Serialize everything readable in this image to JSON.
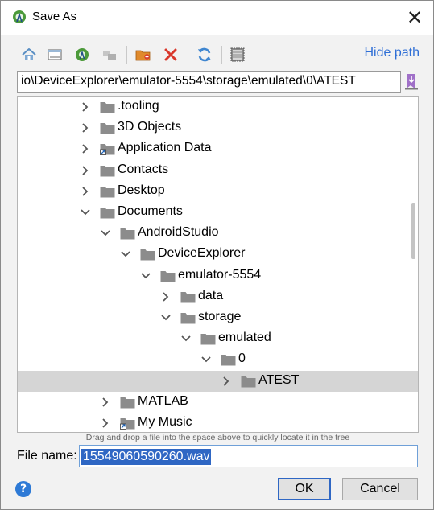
{
  "window": {
    "title": "Save As",
    "close_label": "✕"
  },
  "toolbar": {
    "buttons": [
      "home-icon",
      "desktop-icon",
      "android-project-icon",
      "modules-icon",
      "new-folder-icon",
      "delete-icon",
      "refresh-icon",
      "show-hidden-icon"
    ],
    "hide_path_label": "Hide path"
  },
  "path": {
    "value": "io\\DeviceExplorer\\emulator-5554\\storage\\emulated\\0\\ATEST"
  },
  "tree": {
    "items": [
      {
        "label": ".tooling",
        "expanded": false,
        "depth": 0,
        "shortcut": false
      },
      {
        "label": "3D Objects",
        "expanded": false,
        "depth": 0,
        "shortcut": false
      },
      {
        "label": "Application Data",
        "expanded": false,
        "depth": 0,
        "shortcut": true
      },
      {
        "label": "Contacts",
        "expanded": false,
        "depth": 0,
        "shortcut": false
      },
      {
        "label": "Desktop",
        "expanded": false,
        "depth": 0,
        "shortcut": false
      },
      {
        "label": "Documents",
        "expanded": true,
        "depth": 0,
        "shortcut": false
      },
      {
        "label": "AndroidStudio",
        "expanded": true,
        "depth": 1,
        "shortcut": false
      },
      {
        "label": "DeviceExplorer",
        "expanded": true,
        "depth": 2,
        "shortcut": false
      },
      {
        "label": "emulator-5554",
        "expanded": true,
        "depth": 3,
        "shortcut": false
      },
      {
        "label": "data",
        "expanded": false,
        "depth": 4,
        "shortcut": false
      },
      {
        "label": "storage",
        "expanded": true,
        "depth": 4,
        "shortcut": false
      },
      {
        "label": "emulated",
        "expanded": true,
        "depth": 5,
        "shortcut": false
      },
      {
        "label": "0",
        "expanded": true,
        "depth": 6,
        "shortcut": false
      },
      {
        "label": "ATEST",
        "expanded": false,
        "depth": 7,
        "shortcut": false,
        "selected": true
      },
      {
        "label": "MATLAB",
        "expanded": false,
        "depth": 1,
        "shortcut": false
      },
      {
        "label": "My Music",
        "expanded": false,
        "depth": 1,
        "shortcut": true
      }
    ]
  },
  "hint": "Drag and drop a file into the space above to quickly locate it in the tree",
  "file_name": {
    "label": "File name:",
    "value": "15549060590260.wav"
  },
  "buttons": {
    "ok": "OK",
    "cancel": "Cancel",
    "help": "?"
  },
  "colors": {
    "accent": "#2f67c4",
    "selected_row": "#d5d5d5",
    "link": "#2f6fd6",
    "folder": "#8c8c8c"
  }
}
